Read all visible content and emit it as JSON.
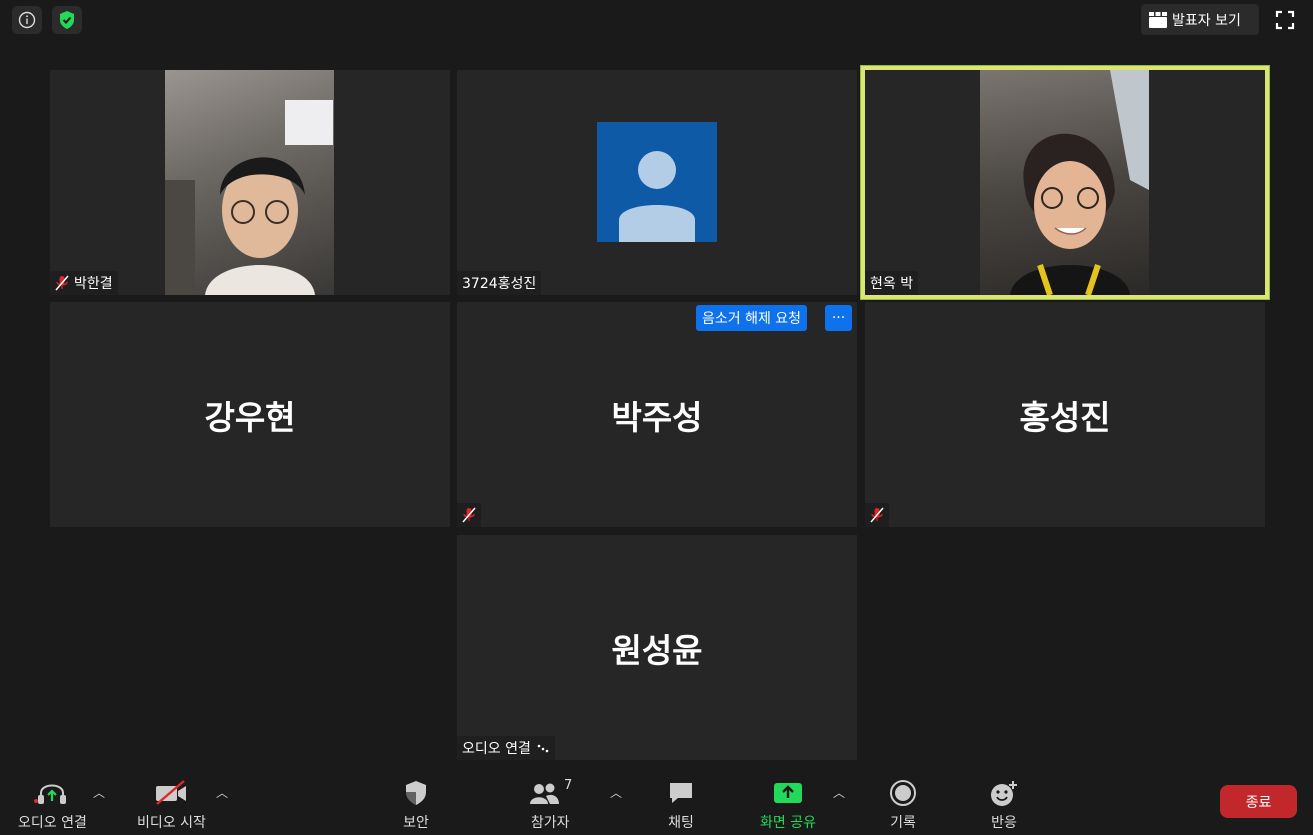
{
  "top_bar": {
    "info_icon": "info-icon",
    "security_icon": "shield-check-icon",
    "speaker_view_label": "발표자 보기",
    "fullscreen_icon": "fullscreen-icon"
  },
  "tiles": [
    {
      "name": "박한결",
      "video": true,
      "muted": true
    },
    {
      "name": "3724홍성진",
      "video": false,
      "avatar": true,
      "muted": false
    },
    {
      "name": "현옥 박",
      "video": true,
      "muted": false,
      "active_speaker": true
    },
    {
      "name": "강우현",
      "video": false,
      "muted": false
    },
    {
      "name": "박주성",
      "video": false,
      "muted": true,
      "request_label": "음소거 해제 요청",
      "more_label": "···"
    },
    {
      "name": "홍성진",
      "video": false,
      "muted": true
    },
    {
      "name": "원성윤",
      "video": false,
      "muted": false,
      "status_label": "오디오 연결"
    }
  ],
  "toolbar": {
    "audio_label": "오디오 연결",
    "video_label": "비디오 시작",
    "security_label": "보안",
    "participants_label": "참가자",
    "participants_count": "7",
    "chat_label": "채팅",
    "share_label": "화면 공유",
    "record_label": "기록",
    "reactions_label": "반응",
    "end_label": "종료"
  },
  "colors": {
    "active_border": "#dde476",
    "share_green": "#23d959",
    "end_red": "#c2282b",
    "accent_blue": "#0e72ed",
    "avatar_bg": "#0e5aa7"
  }
}
